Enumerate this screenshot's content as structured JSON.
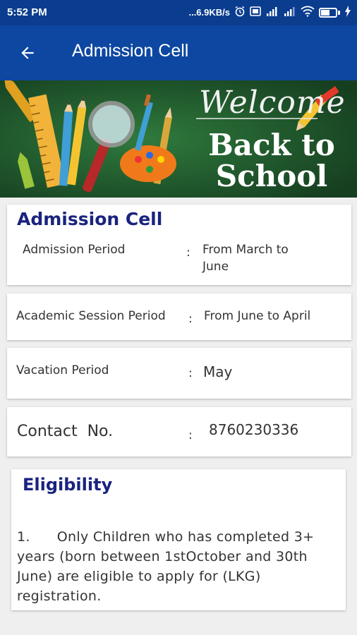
{
  "statusbar": {
    "time": "5:52 PM",
    "speed": "...6.9KB/s",
    "network": "4G",
    "battery": "58",
    "battery_level": 0.58
  },
  "appbar": {
    "title": "Admission Cell",
    "back_icon": "arrow-left-icon"
  },
  "banner": {
    "welcome": "Welcome",
    "headline_1": "Back to",
    "headline_2": "School"
  },
  "admission": {
    "title": "Admission Cell",
    "period_label": "Admission Period",
    "period_colon": ":",
    "period_value": "From March to June"
  },
  "session": {
    "label": "Academic Session Period",
    "colon": ":",
    "value": "From June to April"
  },
  "vacation": {
    "label": "Vacation Period",
    "colon": ":",
    "value": "May"
  },
  "contact": {
    "label": "Contact  No.",
    "colon": ":",
    "value": "8760230336"
  },
  "eligibility": {
    "title": "Eligibility",
    "text": "1.      Only Children who has completed 3+ years (born between 1stOctober and 30th June) are eligible to apply for (LKG) registration."
  },
  "colors": {
    "statusbar": "#0b3d8f",
    "appbar": "#0d47a1",
    "title": "#1a237e",
    "banner": "#1f5a2e"
  }
}
